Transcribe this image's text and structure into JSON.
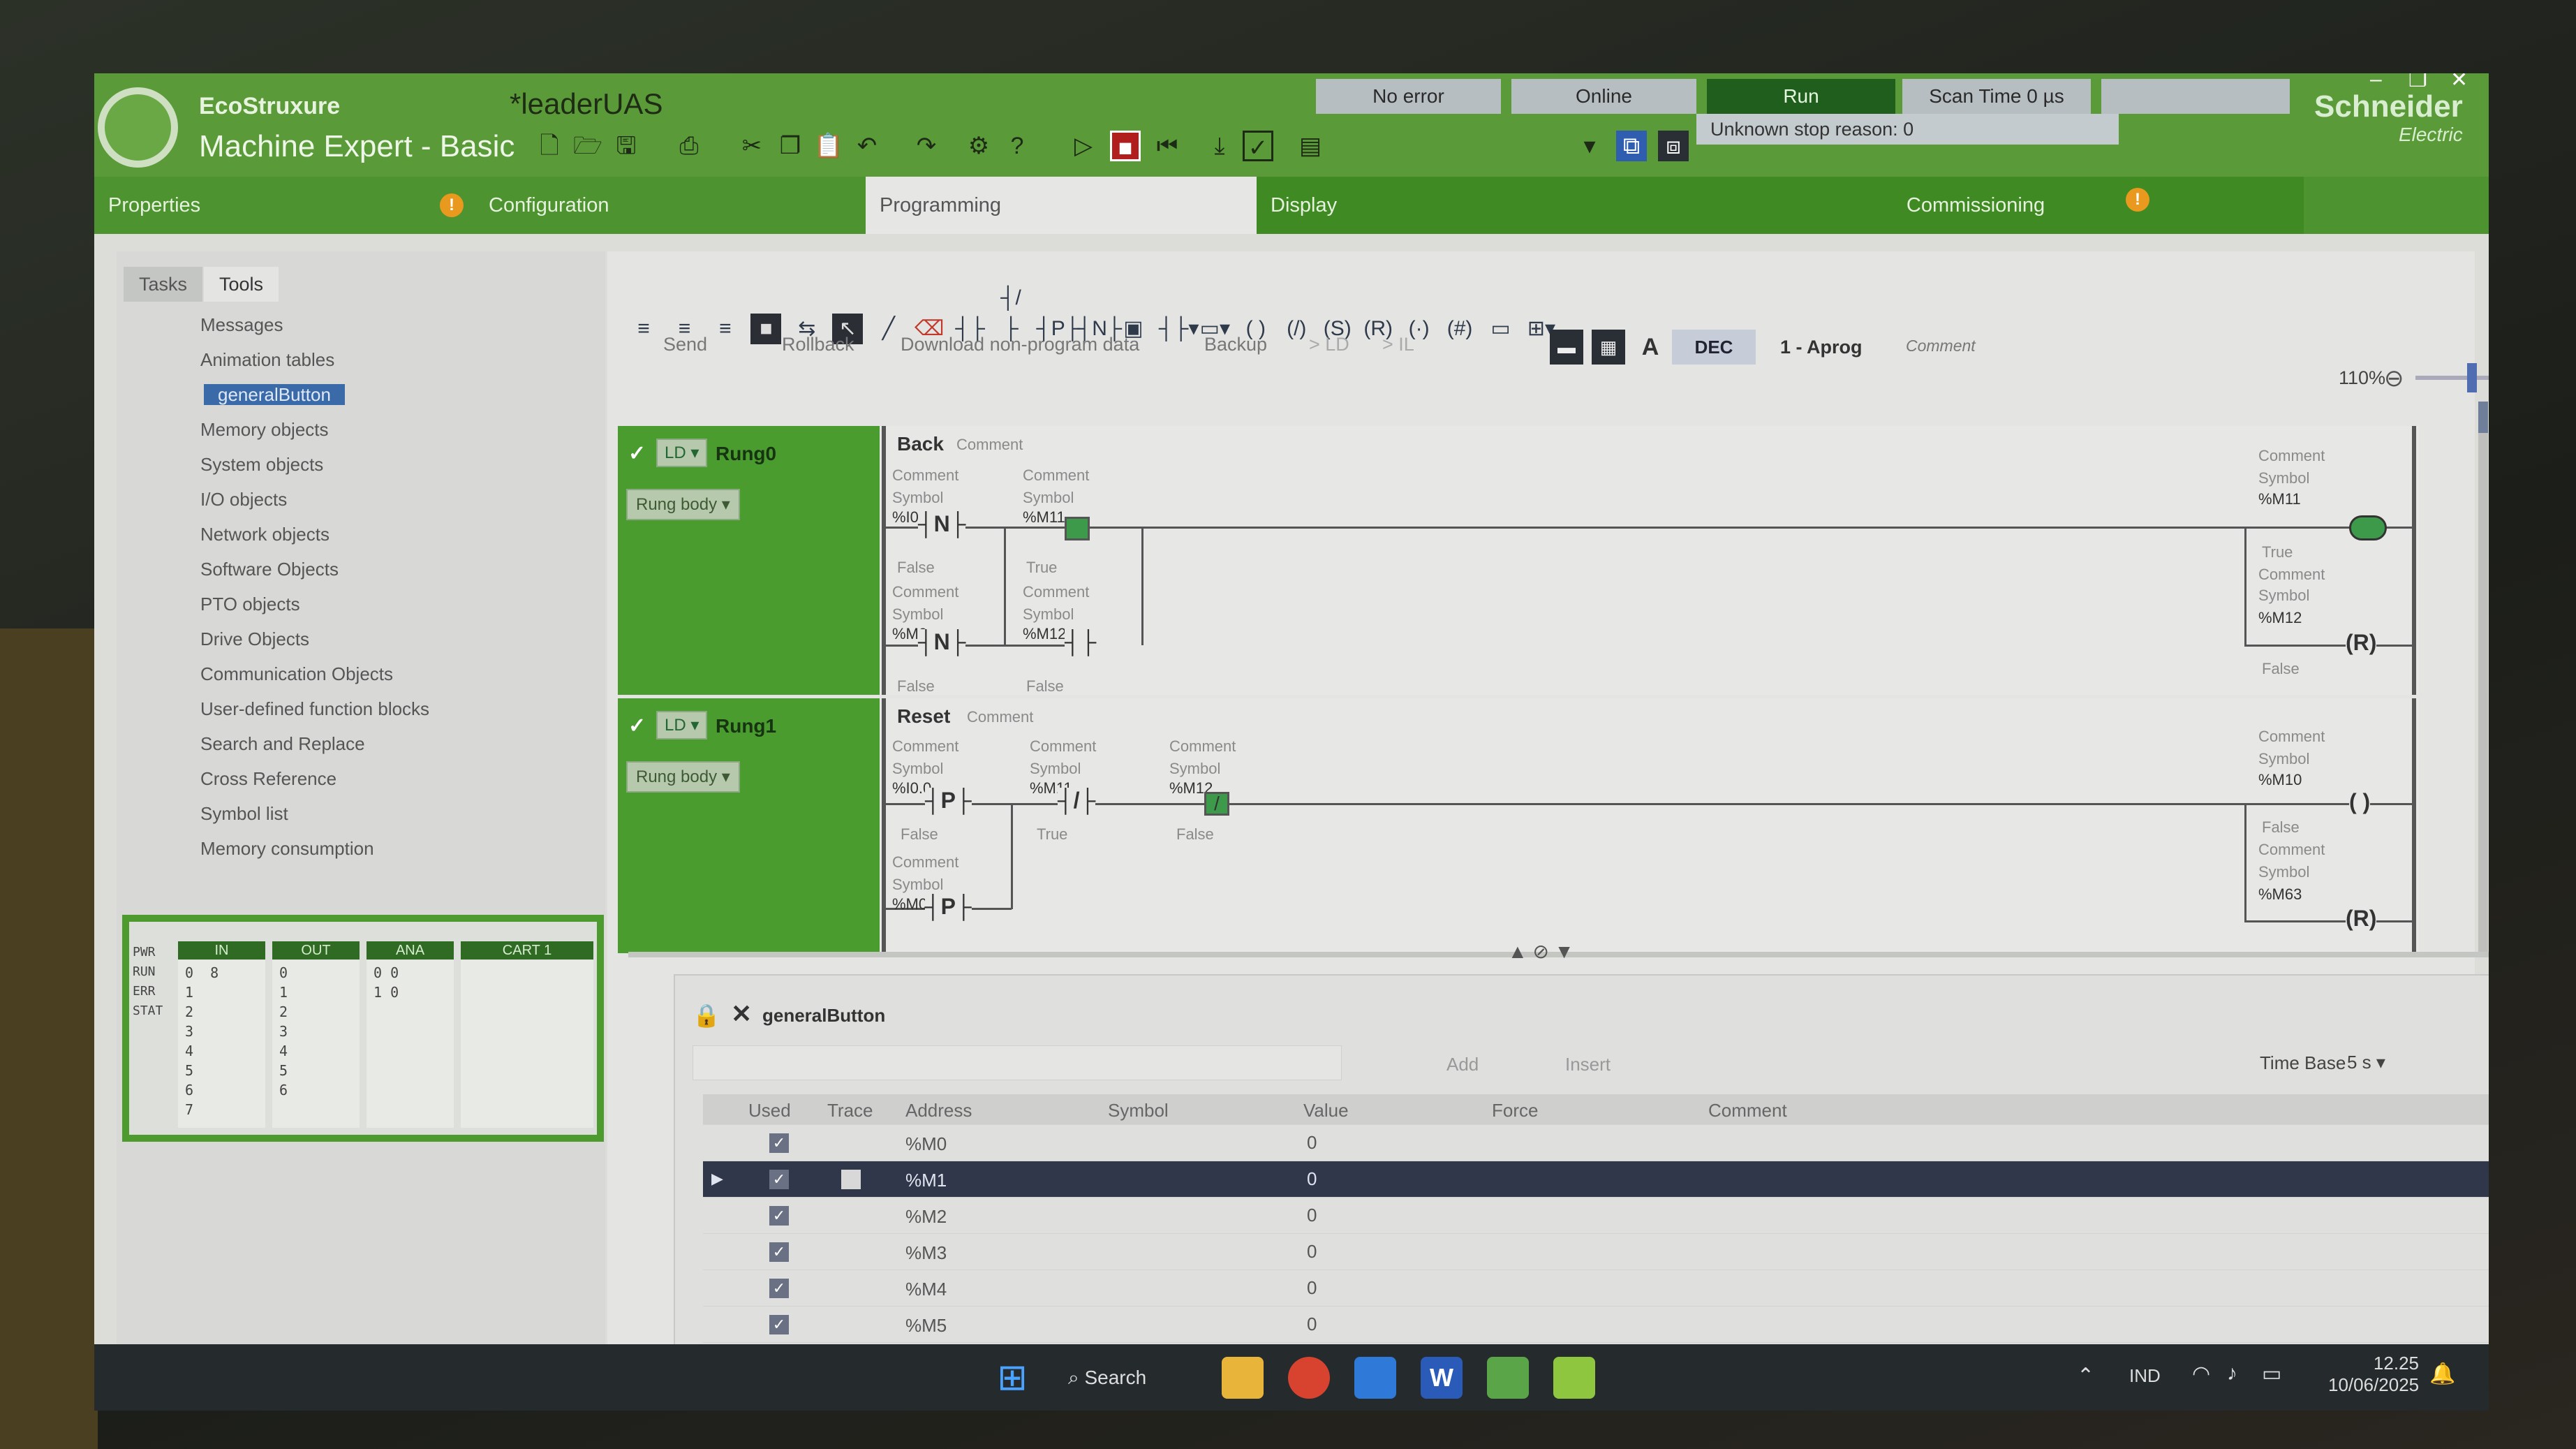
{
  "app": {
    "brand_top": "EcoStruxure",
    "brand_bottom": "Machine Expert - Basic",
    "document": "*leaderUAS",
    "vendor": "Schneider",
    "vendor_sub": "Electric"
  },
  "status": {
    "error": "No error",
    "online": "Online",
    "run": "Run",
    "scan": "Scan Time 0 µs",
    "stop_reason": "Unknown stop reason: 0"
  },
  "tabs": {
    "properties": "Properties",
    "configuration": "Configuration",
    "programming": "Programming",
    "display": "Display",
    "commissioning": "Commissioning"
  },
  "panel": {
    "tab_tasks": "Tasks",
    "tab_tools": "Tools",
    "items": [
      "Messages",
      "Animation tables",
      "generalButton",
      "Memory objects",
      "System objects",
      "I/O objects",
      "Network objects",
      "Software Objects",
      "PTO objects",
      "Drive Objects",
      "Communication Objects",
      "User-defined function blocks",
      "Search and Replace",
      "Cross Reference",
      "Symbol list",
      "Memory consumption"
    ]
  },
  "monitor": {
    "rows_label": "PWR\nRUN\nERR\nSTAT",
    "cols": [
      "IN",
      "OUT",
      "ANA",
      "CART 1"
    ],
    "in_vals": "0  8\n1\n2\n3\n4\n5\n6\n7",
    "out_vals": "0\n1\n2\n3\n4\n5\n6",
    "ana_vals": "0 0\n1 0"
  },
  "editor": {
    "send": "Send",
    "rollback": "Rollback",
    "download": "Download non-program data",
    "backup": "Backup",
    "ld_btn": "> LD",
    "il_btn": "> IL",
    "dec": "DEC",
    "pou": "1 - Aprog",
    "comment": "Comment",
    "zoom": "110%"
  },
  "rungs": [
    {
      "lang": "LD",
      "name": "Rung0",
      "body": "Rung body",
      "title": "Back",
      "comment": "Comment"
    },
    {
      "lang": "LD",
      "name": "Rung1",
      "body": "Rung body",
      "title": "Reset",
      "comment": "Comment"
    }
  ],
  "ladder": {
    "comment": "Comment",
    "symbol": "Symbol",
    "r0": {
      "c1": "%I0.0",
      "c2": "%M11",
      "c3": "%M0",
      "c4": "%M12",
      "coil1": "%M11",
      "coil2": "%M12",
      "s1": "False",
      "s2": "True",
      "s3": "False",
      "s4": "False",
      "cs1": "True",
      "cs2": "False"
    },
    "r1": {
      "c1": "%I0.0",
      "c2": "%M11",
      "c3": "%M12",
      "c4": "%M0",
      "coil1": "%M10",
      "coil2": "%M63",
      "s1": "False",
      "s2": "True",
      "s3": "False",
      "cs1": "False"
    }
  },
  "anim": {
    "title": "generalButton",
    "add": "Add",
    "insert": "Insert",
    "timebase_label": "Time Base",
    "timebase": "5 s",
    "headers": [
      "Used",
      "Trace",
      "Address",
      "Symbol",
      "Value",
      "Force",
      "Comment"
    ],
    "rows": [
      {
        "addr": "%M0",
        "val": "0"
      },
      {
        "addr": "%M1",
        "val": "0"
      },
      {
        "addr": "%M2",
        "val": "0"
      },
      {
        "addr": "%M3",
        "val": "0"
      },
      {
        "addr": "%M4",
        "val": "0"
      },
      {
        "addr": "%M5",
        "val": "0"
      }
    ]
  },
  "taskbar": {
    "search": "Search",
    "lang": "IND",
    "time": "12.25",
    "date": "10/06/2025"
  }
}
